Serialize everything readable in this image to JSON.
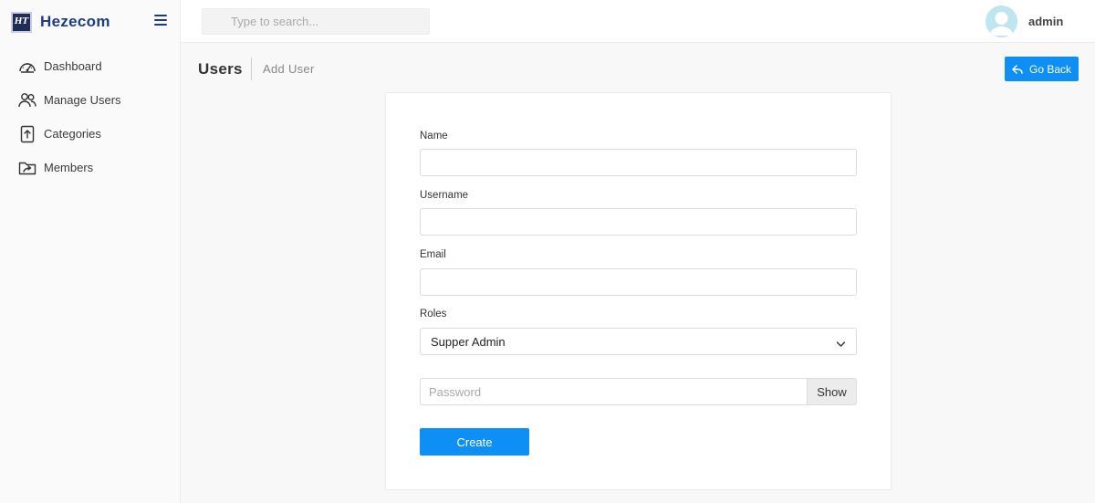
{
  "brand": {
    "logo_text": "HT",
    "name": "Hezecom"
  },
  "sidebar": {
    "items": [
      {
        "label": "Dashboard",
        "icon": "dashboard-gauge-icon"
      },
      {
        "label": "Manage Users",
        "icon": "users-icon"
      },
      {
        "label": "Categories",
        "icon": "upload-file-icon"
      },
      {
        "label": "Members",
        "icon": "folder-share-icon"
      }
    ]
  },
  "topbar": {
    "search_placeholder": "Type to search...",
    "user_name": "admin"
  },
  "page": {
    "title": "Users",
    "subtitle": "Add User",
    "go_back_label": "Go Back"
  },
  "form": {
    "name_label": "Name",
    "name_value": "",
    "username_label": "Username",
    "username_value": "",
    "email_label": "Email",
    "email_value": "",
    "roles_label": "Roles",
    "roles_selected": "Supper Admin",
    "password_placeholder": "Password",
    "show_label": "Show",
    "create_label": "Create"
  },
  "colors": {
    "accent": "#0d8ff5",
    "brand": "#1c3d86",
    "avatar": "#bfe5ee"
  }
}
